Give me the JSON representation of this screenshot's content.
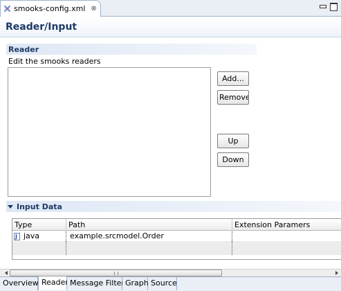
{
  "editor_tab": {
    "title": "smooks-config.xml",
    "close_glyph": "⊗",
    "icon": "smooks-file-icon"
  },
  "window_controls": {
    "minimize": "minimize-icon",
    "maximize": "maximize-icon"
  },
  "form": {
    "title": "Reader/Input"
  },
  "reader_section": {
    "title": "Reader",
    "description": "Edit the smooks readers",
    "buttons": {
      "add": "Add...",
      "remove": "Remove",
      "up": "Up",
      "down": "Down"
    }
  },
  "input_section": {
    "title": "Input Data",
    "columns": [
      "Type",
      "Path",
      "Extension Paramers"
    ],
    "rows": [
      {
        "type": "java",
        "path": "example.srcmodel.Order",
        "extension": ""
      }
    ]
  },
  "page_tabs": [
    "Overview",
    "Reader",
    "Message Filter",
    "Graph",
    "Source"
  ],
  "active_page_tab": "Reader",
  "colors": {
    "title": "#1f3a66",
    "section_bg": "#dde7f4",
    "border": "#9fb1cc"
  }
}
